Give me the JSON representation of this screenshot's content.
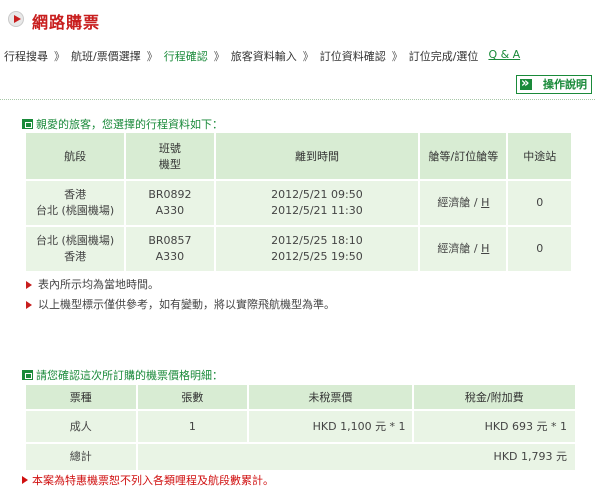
{
  "header": {
    "title": "網路購票"
  },
  "steps": [
    {
      "label": "行程搜尋",
      "active": false
    },
    {
      "label": "航班/票價選擇",
      "active": false
    },
    {
      "label": "行程確認",
      "active": true
    },
    {
      "label": "旅客資料輸入",
      "active": false
    },
    {
      "label": "訂位資料確認",
      "active": false
    },
    {
      "label": "訂位完成/選位",
      "active": false
    }
  ],
  "step_separator": "》",
  "qa_link": "Q & A",
  "help_button": "操作說明",
  "itinerary": {
    "section_title": "親愛的旅客，您選擇的行程資料如下：",
    "headers": {
      "segment": "航段",
      "flight_line1": "班號",
      "flight_line2": "機型",
      "datetime": "離到時間",
      "cabin": "艙等/訂位艙等",
      "stops": "中途站"
    },
    "rows": [
      {
        "from": "香港",
        "to": "台北 (桃園機場)",
        "flight": "BR0892",
        "aircraft": "A330",
        "depart": "2012/5/21 09:50",
        "arrive": "2012/5/21 11:30",
        "cabin": "經濟艙",
        "booking_class": "H",
        "stops": "0"
      },
      {
        "from": "台北 (桃園機場)",
        "to": "香港",
        "flight": "BR0857",
        "aircraft": "A330",
        "depart": "2012/5/25 18:10",
        "arrive": "2012/5/25 19:50",
        "cabin": "經濟艙",
        "booking_class": "H",
        "stops": "0"
      }
    ],
    "cabin_separator": " / ",
    "notes": [
      "表內所示均為當地時間。",
      "以上機型標示僅供參考，如有變動，將以實際飛航機型為準。"
    ]
  },
  "pricing": {
    "section_title": "請您確認這次所訂購的機票價格明細：",
    "headers": {
      "ticket_type": "票種",
      "count": "張數",
      "fare": "未稅票價",
      "tax": "稅金/附加費"
    },
    "rows": [
      {
        "ticket_type": "成人",
        "count": "1",
        "fare": "HKD 1,100 元 * 1",
        "tax": "HKD 693 元 * 1"
      }
    ],
    "total_label": "總計",
    "total_value": "HKD 1,793 元"
  },
  "warning": "本案為特惠機票恕不列入各類哩程及航段數累計。",
  "colors": {
    "brand_red": "#c81e1e",
    "brand_green": "#1a8a3a",
    "header_cell": "#d8ecd3",
    "body_cell": "#e9f4e5"
  }
}
